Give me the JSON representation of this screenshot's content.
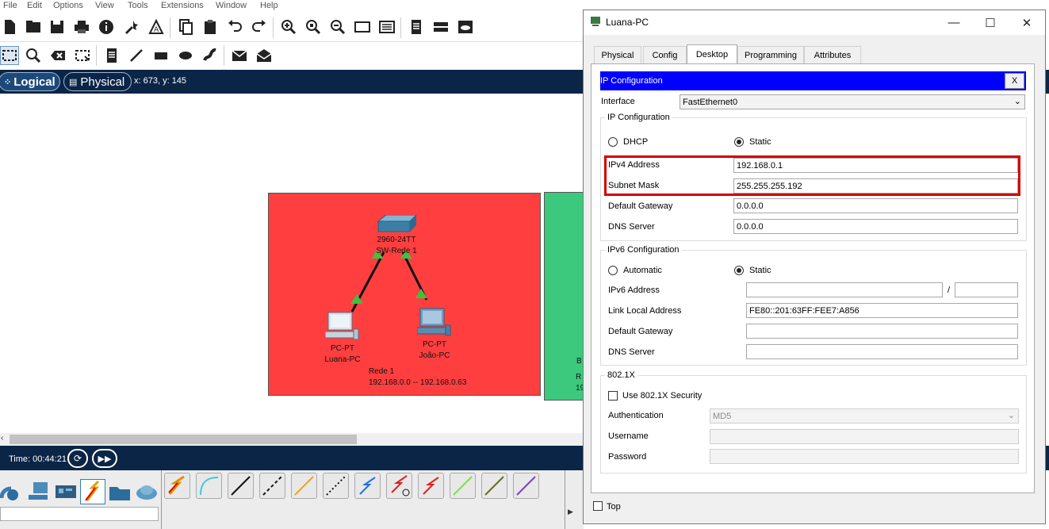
{
  "menu": [
    "File",
    "Edit",
    "Options",
    "View",
    "Tools",
    "Extensions",
    "Window",
    "Help"
  ],
  "viewbar": {
    "logical_label": "Logical",
    "physical_label": "Physical",
    "coords": "x: 673, y: 145"
  },
  "workspace": {
    "switch_model": "2960-24TT",
    "switch_name": "SW-Rede 1",
    "pc1_type": "PC-PT",
    "pc1_name": "Luana-PC",
    "pc2_type": "PC-PT",
    "pc2_name": "João-PC",
    "network_name": "Rede 1",
    "network_range": "192.168.0.0 -- 192.168.0.63",
    "rede2_partial1": "B",
    "rede2_partial2": "R",
    "rede2_partial3": "19",
    "colors": {
      "rede1": "#ff3f3f",
      "rede2": "#3cc97e"
    }
  },
  "bottom": {
    "time_label": "Time: 00:44:21"
  },
  "dialog": {
    "title": "Luana-PC",
    "tabs": [
      "Physical",
      "Config",
      "Desktop",
      "Programming",
      "Attributes"
    ],
    "active_tab": "Desktop",
    "top_label": "Top",
    "ipconf": {
      "header": "IP Configuration",
      "close": "X",
      "interface_label": "Interface",
      "interface_value": "FastEthernet0",
      "ipv4_group": "IP Configuration",
      "dhcp_label": "DHCP",
      "static_label": "Static",
      "ipv4_label": "IPv4 Address",
      "ipv4_value": "192.168.0.1",
      "mask_label": "Subnet Mask",
      "mask_value": "255.255.255.192",
      "gw_label": "Default Gateway",
      "gw_value": "0.0.0.0",
      "dns_label": "DNS Server",
      "dns_value": "0.0.0.0",
      "ipv6_group": "IPv6 Configuration",
      "auto_label": "Automatic",
      "static6_label": "Static",
      "ipv6_label": "IPv6 Address",
      "ipv6_value": "",
      "ipv6_slash": "/",
      "ipv6_prefix": "",
      "lla_label": "Link Local Address",
      "lla_value": "FE80::201:63FF:FEE7:A856",
      "gw6_label": "Default Gateway",
      "gw6_value": "",
      "dns6_label": "DNS Server",
      "dns6_value": "",
      "dot1x_group": "802.1X",
      "use8021x_label": "Use 802.1X Security",
      "auth_label": "Authentication",
      "auth_value": "MD5",
      "user_label": "Username",
      "user_value": "",
      "pass_label": "Password",
      "pass_value": ""
    }
  }
}
